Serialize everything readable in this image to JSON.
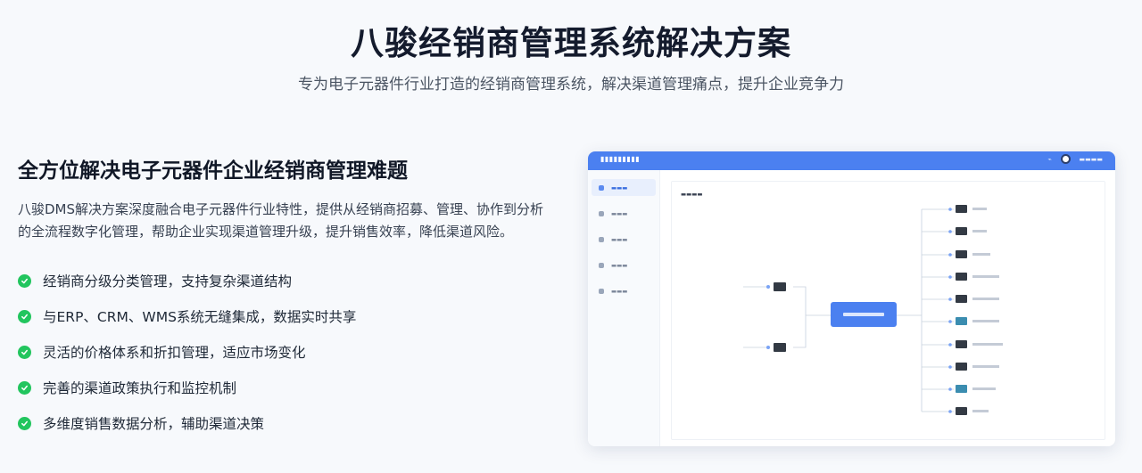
{
  "header": {
    "title": "八骏经销商管理系统解决方案",
    "subtitle": "专为电子元器件行业打造的经销商管理系统，解决渠道管理痛点，提升企业竞争力"
  },
  "section": {
    "title": "全方位解决电子元器件企业经销商管理难题",
    "description": "八骏DMS解决方案深度融合电子元器件行业特性，提供从经销商招募、管理、协作到分析的全流程数字化管理，帮助企业实现渠道管理升级，提升销售效率，降低渠道风险。",
    "features": [
      "经销商分级分类管理，支持复杂渠道结构",
      "与ERP、CRM、WMS系统无缝集成，数据实时共享",
      "灵活的价格体系和折扣管理，适应市场变化",
      "完善的渠道政策执行和监控机制",
      "多维度销售数据分析，辅助渠道决策"
    ]
  },
  "screenshot": {
    "accent_color": "#4b80f0",
    "check_color": "#22c55e"
  }
}
